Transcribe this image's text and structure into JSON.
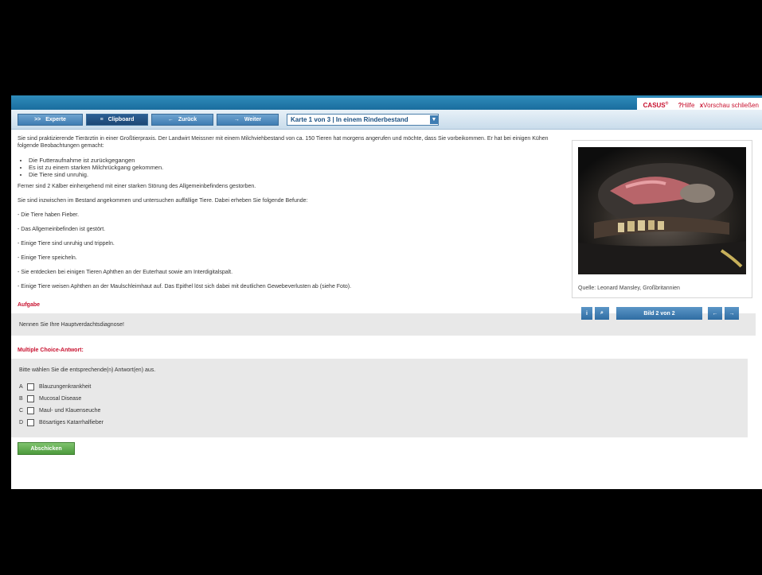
{
  "topbar": {
    "brand": "CASUS",
    "brand_mark": "®",
    "help_label": "Hilfe",
    "help_icon": "?",
    "close_label": "Vorschau schließen",
    "close_icon": "x"
  },
  "toolbar": {
    "buttons": [
      {
        "icon": ">>",
        "label": "Experte"
      },
      {
        "icon": "≡",
        "label": "Clipboard"
      },
      {
        "icon": "←",
        "label": "Zurück"
      },
      {
        "icon": "→",
        "label": "Weiter"
      }
    ],
    "card_select": "Karte 1 von 3 | In einem Rinderbestand"
  },
  "content": {
    "intro": "Sie sind praktizierende Tierärztin in einer Großtierpraxis. Der Landwirt Meissner mit einem Milchviehbestand von ca. 150 Tieren hat morgens angerufen und möchte, dass Sie vorbeikommen. Er hat bei einigen Kühen folgende Beobachtungen gemacht:",
    "observations": [
      "Die Futteraufnahme ist zurückgegangen",
      "Es ist zu einem starken Milchrückgang gekommen.",
      "Die Tiere sind unruhig."
    ],
    "calves": "Ferner sind 2 Kälber einhergehend mit einer starken Störung des Allgemeinbefindens gestorben.",
    "arrival": "Sie sind inzwischen im Bestand angekommen und untersuchen auffällige Tiere. Dabei erheben Sie folgende Befunde:",
    "findings": [
      "- Die Tiere haben Fieber.",
      "- Das Allgemeinbefinden ist gestört.",
      "- Einige Tiere sind unruhig und trippeln.",
      "- Einige Tiere speicheln.",
      "- Sie entdecken bei einigen Tieren Aphthen an der Euterhaut sowie am Interdigitalspalt.",
      "- Einige Tiere weisen Aphthen an der Maulschleimhaut auf. Das Epithel löst sich dabei mit deutlichen Gewebeverlusten ab (siehe Foto)."
    ]
  },
  "task": {
    "title": "Aufgabe",
    "text": "Nennen Sie Ihre Hauptverdachtsdiagnose!"
  },
  "mc": {
    "title": "Multiple Choice-Antwort:",
    "hint": "Bitte wählen Sie die entsprechende(n) Antwort(en) aus.",
    "options": [
      {
        "letter": "A",
        "label": "Blauzungenkrankheit"
      },
      {
        "letter": "B",
        "label": "Mucosal Disease"
      },
      {
        "letter": "C",
        "label": "Maul- und Klauenseuche"
      },
      {
        "letter": "D",
        "label": "Bösartiges Katarrhalfieber"
      }
    ],
    "submit_label": "Abschicken"
  },
  "image": {
    "caption": "Quelle: Leonard Mansley, Großbritannien",
    "info_icon": "i",
    "zoom_icon": "⌕",
    "counter": "Bild 2 von 2",
    "prev_icon": "←",
    "next_icon": "→"
  },
  "colors": {
    "accent_red": "#c8102e",
    "toolbar_blue": "#3f7db3",
    "submit_green": "#4c9a3c"
  }
}
